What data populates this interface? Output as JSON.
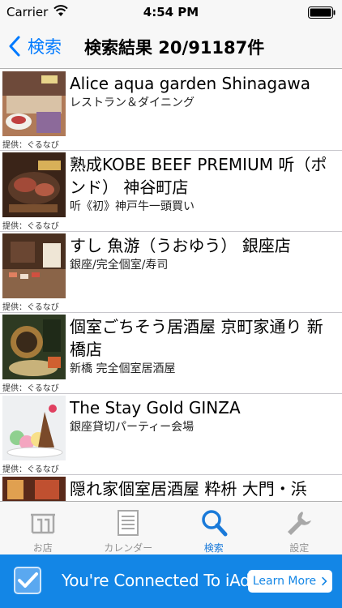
{
  "status_bar": {
    "carrier": "Carrier",
    "time": "4:54 PM"
  },
  "nav": {
    "back_label": "検索",
    "title": "検索結果 20/91187件"
  },
  "results": [
    {
      "title": "Alice aqua garden Shinagawa",
      "subtitle": "レストラン＆ダイニング",
      "credit": "提供：ぐるなび"
    },
    {
      "title": "熟成KOBE BEEF PREMIUM 听（ポンド） 神谷町店",
      "subtitle": "听《初》神戸牛一頭買い",
      "credit": "提供：ぐるなび"
    },
    {
      "title": "すし 魚游（うおゆう） 銀座店",
      "subtitle": "銀座/完全個室/寿司",
      "credit": "提供：ぐるなび"
    },
    {
      "title": "個室ごちそう居酒屋 京町家通り 新橋店",
      "subtitle": "新橋 完全個室居酒屋",
      "credit": "提供：ぐるなび"
    },
    {
      "title": "The Stay Gold GINZA",
      "subtitle": "銀座貸切パーティー会場",
      "credit": "提供：ぐるなび"
    },
    {
      "title": "隠れ家個室居酒屋 粋枡 大門・浜",
      "subtitle": "",
      "credit": ""
    }
  ],
  "tabs": [
    {
      "label": "お店",
      "icon": "shop-icon",
      "active": false
    },
    {
      "label": "カレンダー",
      "icon": "calendar-icon",
      "active": false
    },
    {
      "label": "検索",
      "icon": "search-icon",
      "active": true
    },
    {
      "label": "設定",
      "icon": "wrench-icon",
      "active": false
    }
  ],
  "ad_banner": {
    "text": "You're Connected To iAd",
    "button_label": "Learn More"
  },
  "colors": {
    "accent": "#007aff",
    "tab_active": "#1a7ad9",
    "tab_inactive": "#929292",
    "iad_blue": "#1386e6"
  }
}
